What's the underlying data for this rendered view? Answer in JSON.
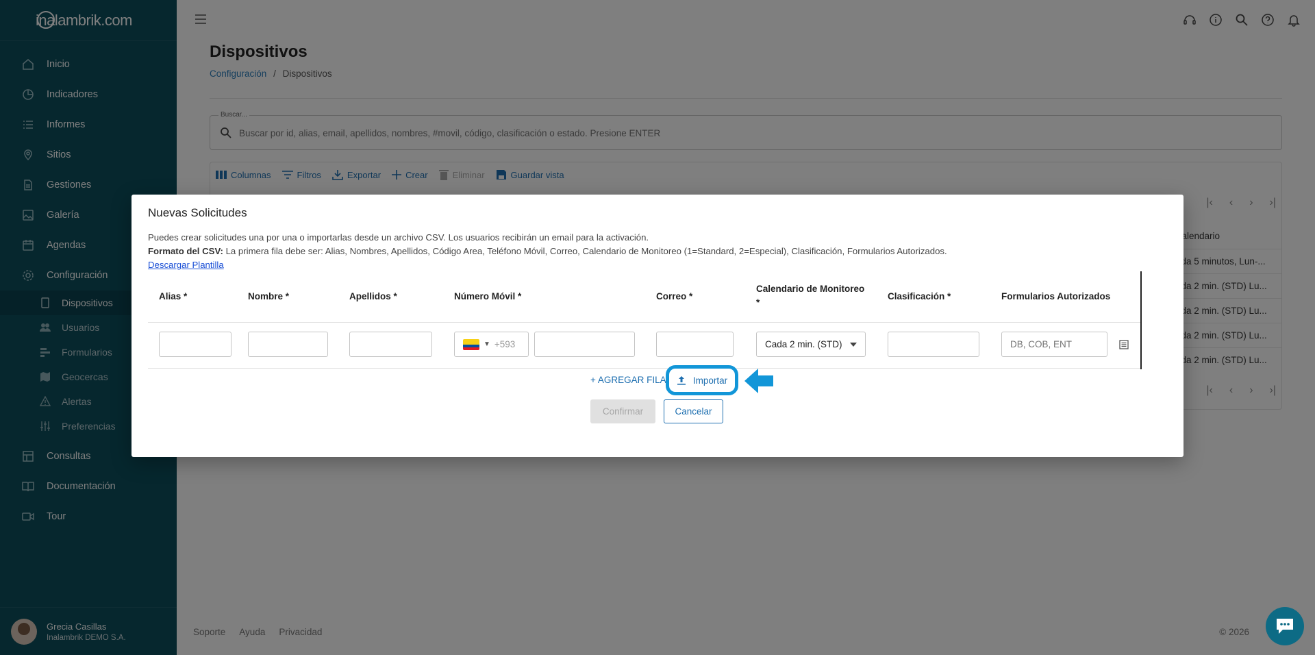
{
  "brand": {
    "name": "inalambrik.com"
  },
  "sidebar": {
    "items": [
      {
        "label": "Inicio",
        "icon": "home-icon"
      },
      {
        "label": "Indicadores",
        "icon": "pie-chart-icon"
      },
      {
        "label": "Informes",
        "icon": "list-icon"
      },
      {
        "label": "Sitios",
        "icon": "map-pin-icon"
      },
      {
        "label": "Gestiones",
        "icon": "document-icon"
      },
      {
        "label": "Galería",
        "icon": "image-icon"
      },
      {
        "label": "Agendas",
        "icon": "calendar-icon"
      },
      {
        "label": "Configuración",
        "icon": "gear-icon"
      }
    ],
    "sub_items": [
      {
        "label": "Dispositivos",
        "icon": "phone-icon",
        "active": true
      },
      {
        "label": "Usuarios",
        "icon": "users-icon"
      },
      {
        "label": "Formularios",
        "icon": "forms-icon"
      },
      {
        "label": "Geocercas",
        "icon": "map-icon"
      },
      {
        "label": "Alertas",
        "icon": "warning-icon"
      },
      {
        "label": "Preferencias",
        "icon": "sliders-icon"
      }
    ],
    "bottom_items": [
      {
        "label": "Consultas",
        "icon": "table-icon"
      },
      {
        "label": "Documentación",
        "icon": "book-icon"
      },
      {
        "label": "Tour",
        "icon": "video-icon"
      }
    ],
    "user": {
      "name": "Grecia Casillas",
      "org": "Inalambrik DEMO S.A."
    }
  },
  "page": {
    "title": "Dispositivos",
    "breadcrumb": {
      "parent": "Configuración",
      "separator": "/",
      "current": "Dispositivos"
    },
    "search": {
      "label": "Buscar...",
      "placeholder": "Buscar por id, alias, email, apellidos, nombres, #movil, código, clasificación o estado. Presione ENTER"
    },
    "toolbar": {
      "columns": "Columnas",
      "filters": "Filtros",
      "export": "Exportar",
      "create": "Crear",
      "delete": "Eliminar",
      "save_view": "Guardar vista"
    },
    "grid": {
      "visible_header": "alendario",
      "visible_rows": [
        "ada 5 minutos, Lun-...",
        "ada 2 min. (STD) Lu...",
        "ada 2 min. (STD) Lu...",
        "ada 2 min. (STD) Lu...",
        "ada 2 min. (STD) Lu..."
      ]
    },
    "footer": {
      "links": [
        "Soporte",
        "Ayuda",
        "Privacidad"
      ],
      "copyright": "© 2026"
    }
  },
  "modal": {
    "title": "Nuevas Solicitudes",
    "desc_line1": "Puedes crear solicitudes una por una o importarlas desde un archivo CSV. Los usuarios recibirán un email para la activación.",
    "desc_format_label": "Formato del CSV:",
    "desc_format_text": " La primera fila debe ser: Alias, Nombres, Apellidos, Código Area, Teléfono Móvil, Correo, Calendario de Monitoreo (1=Standard, 2=Especial), Clasificación, Formularios Autorizados.",
    "download_link": "Descargar Plantilla",
    "columns": {
      "alias": "Alias *",
      "nombre": "Nombre *",
      "apellidos": "Apellidos *",
      "movil": "Número Móvil *",
      "correo": "Correo *",
      "calendario": "Calendario de Monitoreo",
      "calendario_star": "*",
      "clasificacion": "Clasificación *",
      "formularios": "Formularios Autorizados"
    },
    "row": {
      "country_code": "+593",
      "calendario_value": "Cada 2 min. (STD)",
      "formularios_placeholder": "DB, COB, ENT"
    },
    "add_row": "+ AGREGAR FILA",
    "import": "Importar",
    "confirm": "Confirmar",
    "cancel": "Cancelar"
  },
  "colors": {
    "sidebar_bg": "#0d4e5c",
    "accent": "#1e6fb0",
    "highlight": "#1296d8"
  }
}
